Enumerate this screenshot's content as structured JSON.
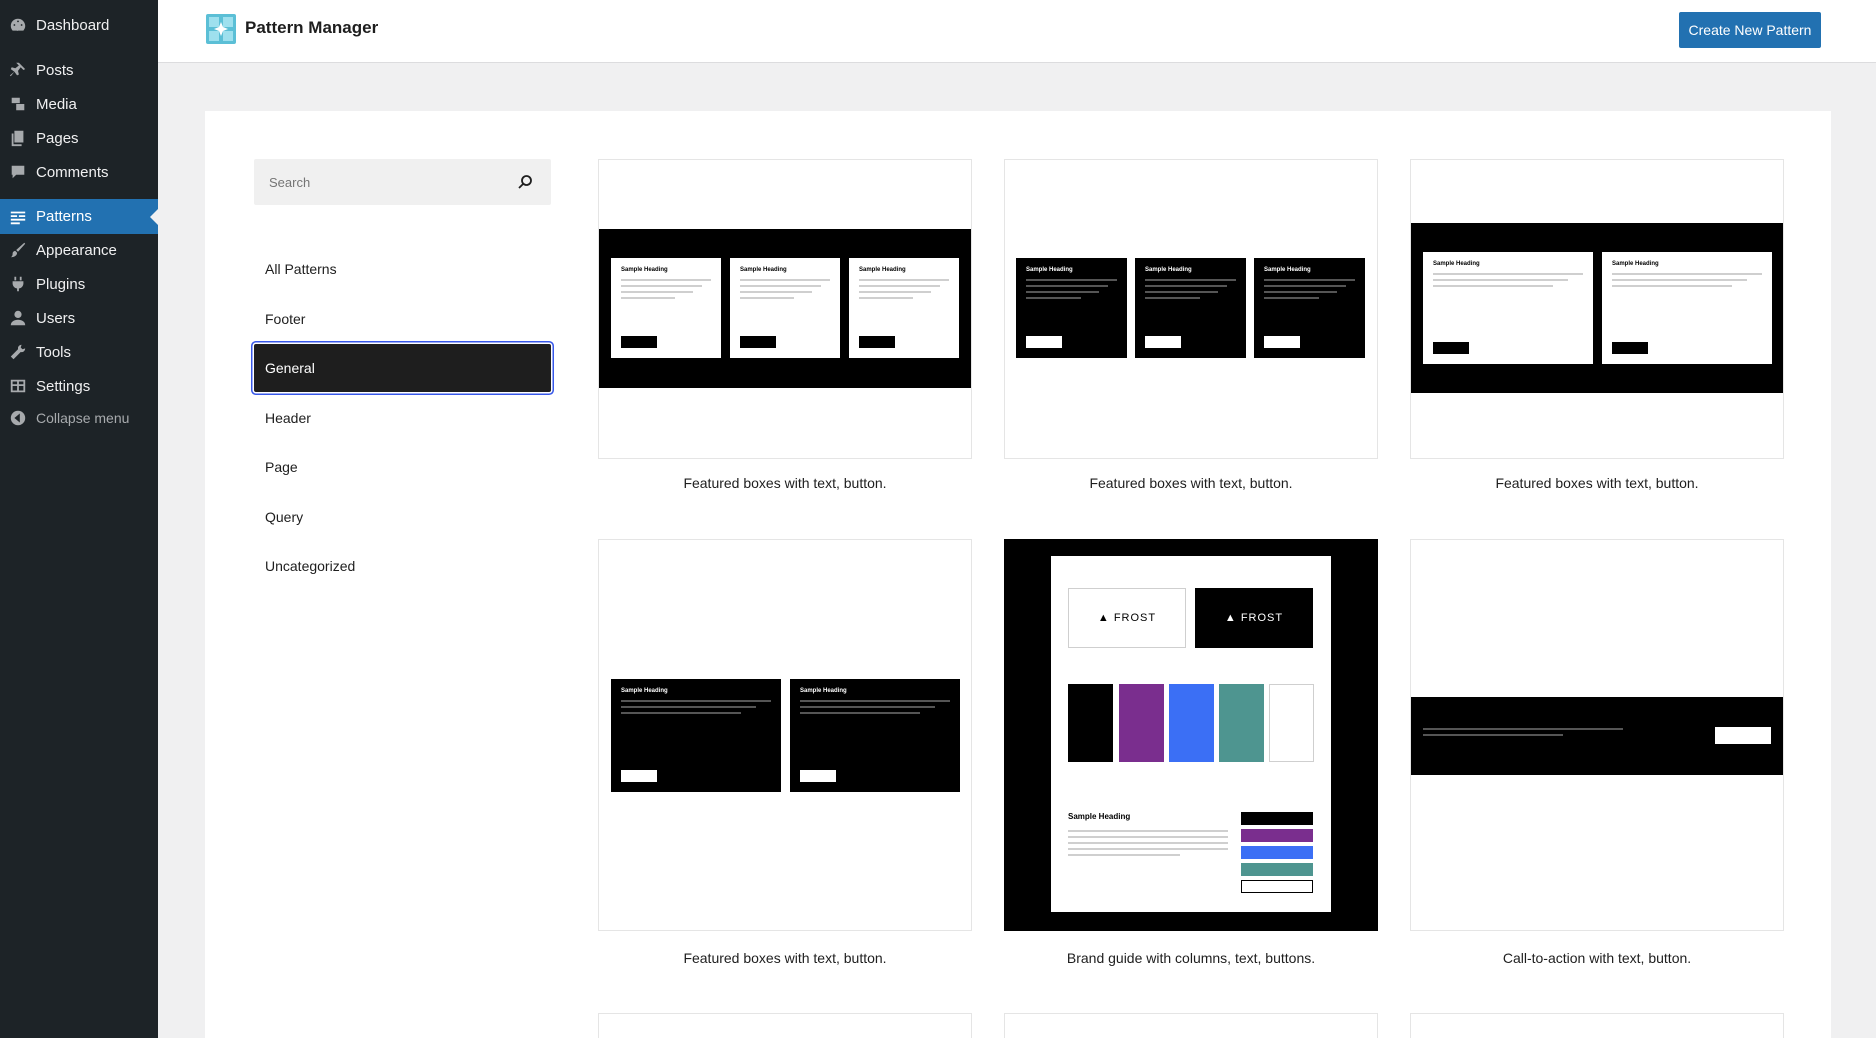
{
  "sidebar": {
    "items": [
      {
        "label": "Dashboard",
        "icon": "dashboard-icon"
      },
      {
        "label": "Posts",
        "icon": "pin-icon"
      },
      {
        "label": "Media",
        "icon": "media-icon"
      },
      {
        "label": "Pages",
        "icon": "pages-icon"
      },
      {
        "label": "Comments",
        "icon": "comments-icon"
      },
      {
        "label": "Patterns",
        "icon": "patterns-icon",
        "current": true
      },
      {
        "label": "Appearance",
        "icon": "paintbrush-icon"
      },
      {
        "label": "Plugins",
        "icon": "plugins-icon"
      },
      {
        "label": "Users",
        "icon": "users-icon"
      },
      {
        "label": "Tools",
        "icon": "wrench-icon"
      },
      {
        "label": "Settings",
        "icon": "settings-icon"
      }
    ],
    "collapse_label": "Collapse menu"
  },
  "header": {
    "title": "Pattern Manager",
    "create_button": "Create New Pattern"
  },
  "search": {
    "placeholder": "Search"
  },
  "categories": [
    {
      "label": "All Patterns"
    },
    {
      "label": "Footer"
    },
    {
      "label": "General",
      "active": true
    },
    {
      "label": "Header"
    },
    {
      "label": "Page"
    },
    {
      "label": "Query"
    },
    {
      "label": "Uncategorized"
    }
  ],
  "patterns": [
    {
      "caption": "Featured boxes with text, button."
    },
    {
      "caption": "Featured boxes with text, button."
    },
    {
      "caption": "Featured boxes with text, button."
    },
    {
      "caption": "Featured boxes with text, button."
    },
    {
      "caption": "Brand guide with columns, text, buttons."
    },
    {
      "caption": "Call-to-action with text, button."
    }
  ],
  "preview": {
    "sample_heading": "Sample Heading",
    "frost_label": "FROST"
  },
  "colors": {
    "admin_bar": "#1d2327",
    "accent": "#2271b1",
    "brand_black": "#000000",
    "brand_purple": "#7a2e8e",
    "brand_blue": "#3b6ff5",
    "brand_teal": "#4e9590",
    "brand_white": "#ffffff"
  }
}
